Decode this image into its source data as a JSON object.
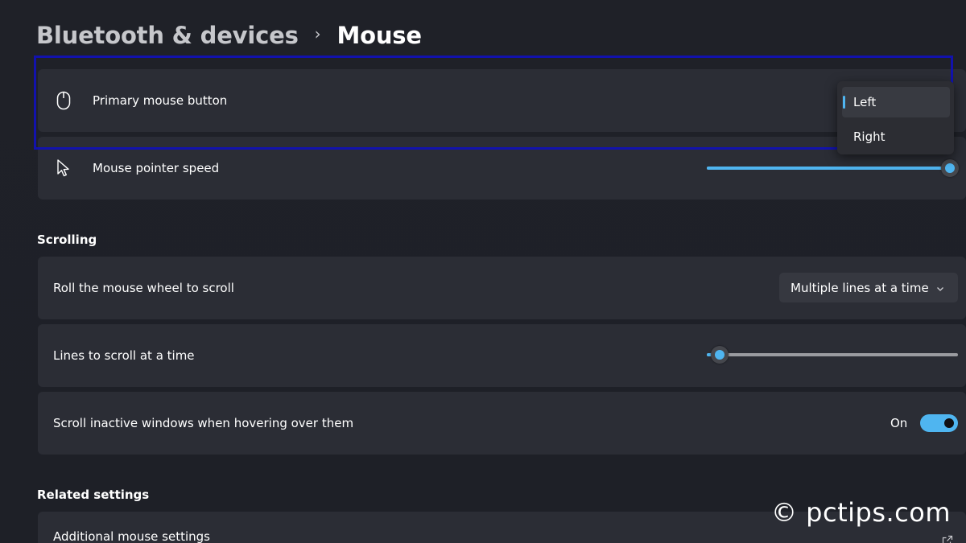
{
  "breadcrumb": {
    "parent": "Bluetooth & devices",
    "separator": "›",
    "current": "Mouse"
  },
  "primary_button": {
    "label": "Primary mouse button",
    "icon": "mouse-icon",
    "options": [
      {
        "label": "Left",
        "selected": true
      },
      {
        "label": "Right",
        "selected": false
      }
    ]
  },
  "pointer_speed": {
    "label": "Mouse pointer speed",
    "icon": "pointer-icon",
    "value_fraction": 1.0
  },
  "scrolling": {
    "title": "Scrolling",
    "roll_wheel": {
      "label": "Roll the mouse wheel to scroll",
      "selected": "Multiple lines at a time"
    },
    "lines": {
      "label": "Lines to scroll at a time",
      "value_fraction": 0.05
    },
    "inactive": {
      "label": "Scroll inactive windows when hovering over them",
      "state_label": "On",
      "on": true
    }
  },
  "related": {
    "title": "Related settings",
    "additional": {
      "label": "Additional mouse settings",
      "icon": "external-link-icon"
    }
  },
  "watermark": "© pctips.com",
  "colors": {
    "accent": "#4fb5f0",
    "highlight_box": "#1212ad"
  }
}
